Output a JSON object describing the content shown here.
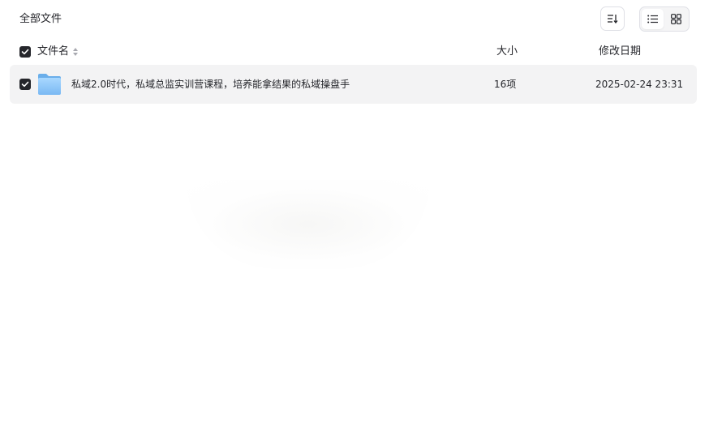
{
  "breadcrumb": {
    "title": "全部文件"
  },
  "toolbar": {
    "sort_icon": "sort-descending-icon",
    "view_list_icon": "list-view-icon",
    "view_grid_icon": "grid-view-icon",
    "active_view": "list"
  },
  "table": {
    "columns": {
      "name": "文件名",
      "size": "大小",
      "date": "修改日期"
    },
    "select_all_checked": true,
    "rows": [
      {
        "checked": true,
        "type": "folder",
        "icon": "folder-icon",
        "name": "私域2.0时代，私域总监实训营课程，培养能拿结果的私域操盘手",
        "size": "16项",
        "modified": "2025-02-24 23:31"
      }
    ]
  },
  "colors": {
    "text": "#25262b",
    "row_selected_bg": "#f3f3f4",
    "checkbox_fill": "#25262b",
    "folder_blue": "#8cc8fa",
    "border": "#dfe0e6"
  }
}
